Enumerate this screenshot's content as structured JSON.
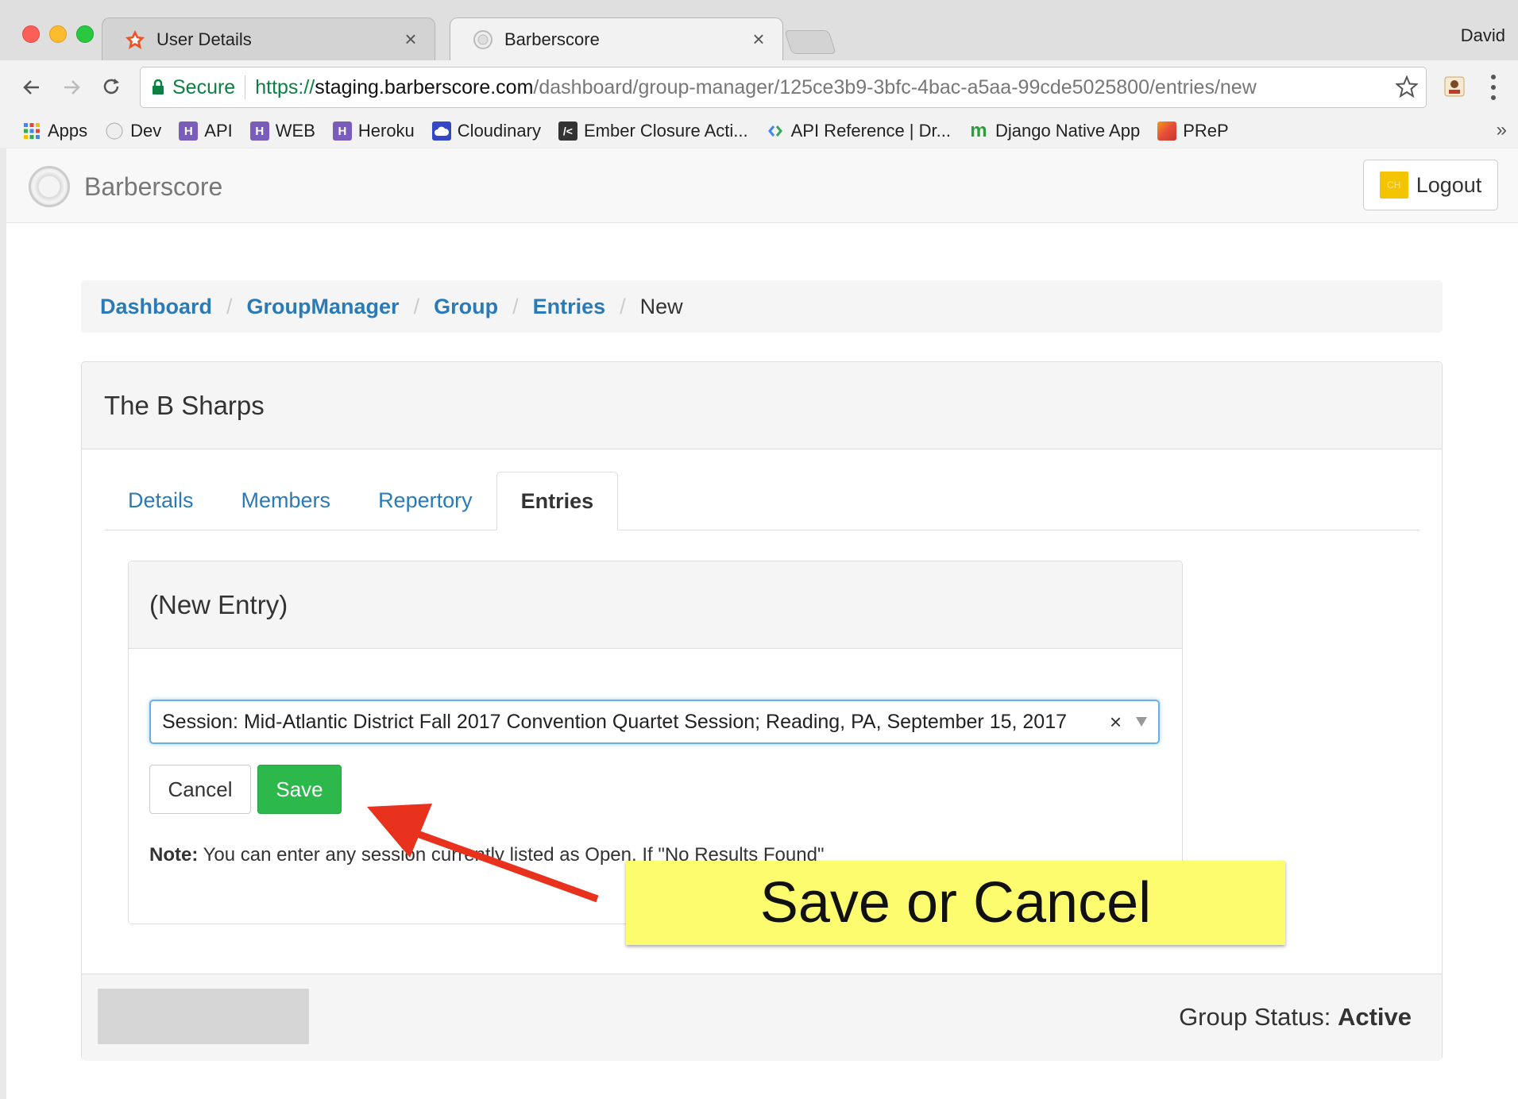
{
  "browser": {
    "tabs": [
      {
        "title": "User Details",
        "icon": "auth0-icon"
      },
      {
        "title": "Barberscore",
        "icon": "barberscore-favicon"
      }
    ],
    "profile_name": "David",
    "secure_label": "Secure",
    "url_scheme": "https://",
    "url_host": "staging.barberscore.com",
    "url_path": "/dashboard/group-manager/125ce3b9-3bfc-4bac-a5aa-99cde5025800/entries/new",
    "bookmarks": [
      {
        "label": "Apps",
        "icon": "apps-grid-icon"
      },
      {
        "label": "Dev",
        "icon": "dev-icon"
      },
      {
        "label": "API",
        "icon": "heroku-icon"
      },
      {
        "label": "WEB",
        "icon": "heroku-icon"
      },
      {
        "label": "Heroku",
        "icon": "heroku-icon"
      },
      {
        "label": "Cloudinary",
        "icon": "cloudinary-icon"
      },
      {
        "label": "Ember Closure Acti...",
        "icon": "ember-icon"
      },
      {
        "label": "API Reference | Dr...",
        "icon": "api-reference-icon"
      },
      {
        "label": "Django Native App",
        "icon": "django-m-icon"
      },
      {
        "label": "PReP",
        "icon": "prep-icon"
      }
    ],
    "more_bookmarks": "»"
  },
  "navbar": {
    "brand": "Barberscore",
    "logout_label": "Logout",
    "logout_badge": "CH"
  },
  "breadcrumb": {
    "items": [
      "Dashboard",
      "GroupManager",
      "Group",
      "Entries"
    ],
    "current": "New",
    "separator": "/"
  },
  "panel": {
    "title": "The B Sharps",
    "tabs": [
      "Details",
      "Members",
      "Repertory",
      "Entries"
    ],
    "active_tab": "Entries"
  },
  "entry_form": {
    "title": "(New Entry)",
    "session_value": "Session: Mid-Atlantic District Fall 2017 Convention Quartet Session; Reading, PA, September 15, 2017",
    "clear_glyph": "×",
    "cancel_label": "Cancel",
    "save_label": "Save",
    "note_label": "Note:",
    "note_text": " You can enter any session currently listed as Open. If \"No Results Found\""
  },
  "footer": {
    "status_label": "Group Status: ",
    "status_value": "Active"
  },
  "annotation": {
    "callout_text": "Save or Cancel"
  },
  "colors": {
    "link": "#2a7ab8",
    "save_button": "#2db84c",
    "callout": "#fdfb6e",
    "arrow": "#e8321e"
  }
}
